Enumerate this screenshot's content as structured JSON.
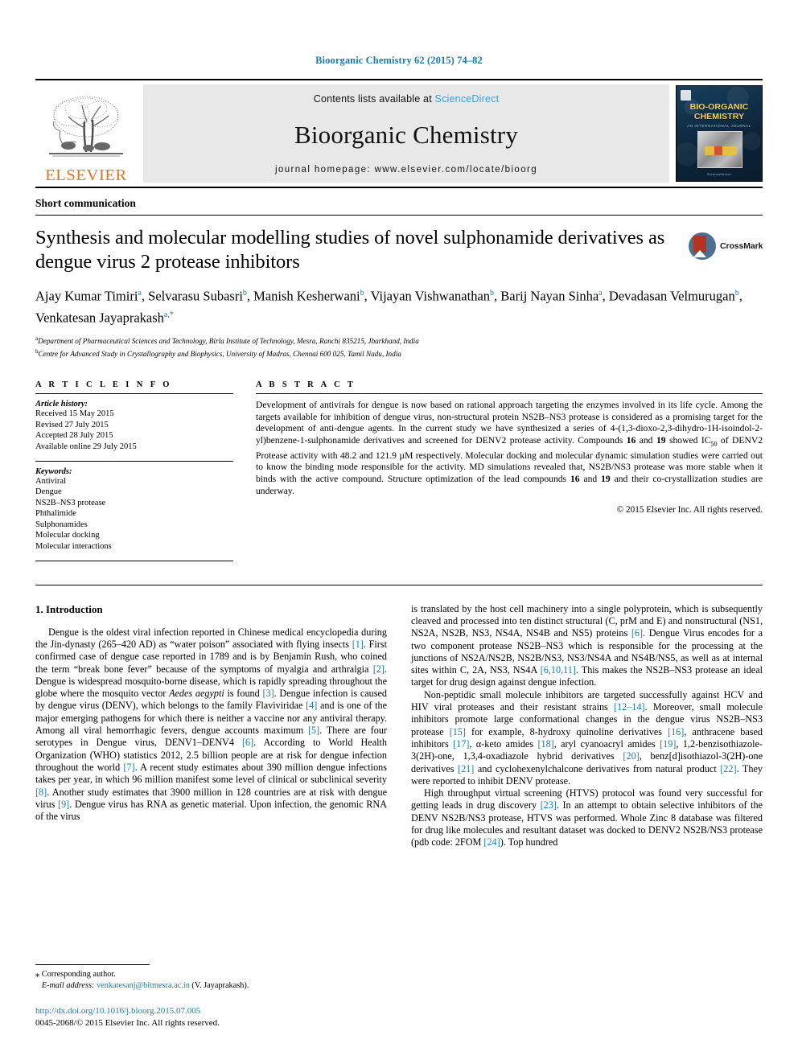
{
  "running_head": "Bioorganic Chemistry 62 (2015) 74–82",
  "masthead": {
    "publisher_name": "ELSEVIER",
    "contents_prefix": "Contents lists available at ",
    "sciencedirect": "ScienceDirect",
    "journal_name": "Bioorganic Chemistry",
    "homepage": "journal homepage: www.elsevier.com/locate/bioorg",
    "cover": {
      "title_line1": "BIO-ORGANIC",
      "title_line2": "CHEMISTRY",
      "subtitle": "AN INTERNATIONAL JOURNAL",
      "footer": "ScienceDirect"
    },
    "accent_blue": "#3b9fd8",
    "elsevier_orange": "#E9711C"
  },
  "article": {
    "type": "Short communication",
    "title": "Synthesis and molecular modelling studies of novel sulphonamide derivatives as dengue virus 2 protease inhibitors",
    "crossmark_label": "CrossMark",
    "authors": [
      {
        "name": "Ajay Kumar Timiri",
        "marks": "a",
        "sep": ", "
      },
      {
        "name": "Selvarasu Subasri",
        "marks": "b",
        "sep": ", "
      },
      {
        "name": "Manish Kesherwani",
        "marks": "b",
        "sep": ", "
      },
      {
        "name": "Vijayan Vishwanathan",
        "marks": "b",
        "sep": ", "
      },
      {
        "name": "Barij Nayan Sinha",
        "marks": "a",
        "sep": ", "
      },
      {
        "name": "Devadasan Velmurugan",
        "marks": "b",
        "sep": ", "
      },
      {
        "name": "Venkatesan Jayaprakash",
        "marks": "a,*",
        "sep": ""
      }
    ],
    "affiliations": [
      {
        "mark": "a",
        "text": "Department of Pharmaceutical Sciences and Technology, Birla Institute of Technology, Mesra, Ranchi 835215, Jharkhand, India"
      },
      {
        "mark": "b",
        "text": "Centre for Advanced Study in Crystallography and Biophysics, University of Madras, Chennai 600 025, Tamil Nadu, India"
      }
    ]
  },
  "info": {
    "heading": "A R T I C L E   I N F O",
    "history_label": "Article history:",
    "history": [
      "Received 15 May 2015",
      "Revised 27 July 2015",
      "Accepted 28 July 2015",
      "Available online 29 July 2015"
    ],
    "keywords_label": "Keywords:",
    "keywords": [
      "Antiviral",
      "Dengue",
      "NS2B–NS3 protease",
      "Phthalimide",
      "Sulphonamides",
      "Molecular docking",
      "Molecular interactions"
    ]
  },
  "abstract": {
    "heading": "A B S T R A C T",
    "part1": "Development of antivirals for dengue is now based on rational approach targeting the enzymes involved in its life cycle. Among the targets available for inhibition of dengue virus, non-structural protein NS2B–NS3 protease is considered as a promising target for the development of anti-dengue agents. In the current study we have synthesized a series of 4-(1,3-dioxo-2,3-dihydro-1H-isoindol-2-yl)benzene-1-sulphonamide derivatives and screened for DENV2 protease activity. Compounds ",
    "bold1": "16",
    "mid1": " and ",
    "bold2": "19",
    "part2": " showed IC",
    "sub": "50",
    "part3": " of DENV2 Protease activity with 48.2 and 121.9 µM respectively. Molecular docking and molecular dynamic simulation studies were carried out to know the binding mode responsible for the activity. MD simulations revealed that, NS2B/NS3 protease was more stable when it binds with the active compound. Structure optimization of the lead compounds ",
    "bold3": "16",
    "mid2": " and ",
    "bold4": "19",
    "part4": " and their co-crystallization studies are underway.",
    "copyright": "© 2015 Elsevier Inc. All rights reserved."
  },
  "body": {
    "section_title": "1. Introduction",
    "left_paragraphs": [
      {
        "segments": [
          {
            "t": "Dengue is the oldest viral infection reported in Chinese medical encyclopedia during the Jin-dynasty (265–420 AD) as “water poison” associated with flying insects "
          },
          {
            "t": "[1]",
            "k": "ref"
          },
          {
            "t": ". First confirmed case of dengue case reported in 1789 and is by Benjamin Rush, who coined the term “break bone fever” because of the symptoms of myalgia and arthralgia "
          },
          {
            "t": "[2]",
            "k": "ref"
          },
          {
            "t": ". Dengue is widespread mosquito-borne disease, which is rapidly spreading throughout the globe where the mosquito vector "
          },
          {
            "t": "Aedes aegypti",
            "k": "ital"
          },
          {
            "t": " is found "
          },
          {
            "t": "[3]",
            "k": "ref"
          },
          {
            "t": ". Dengue infection is caused by dengue virus (DENV), which belongs to the family Flaviviridae "
          },
          {
            "t": "[4]",
            "k": "ref"
          },
          {
            "t": " and is one of the major emerging pathogens for which there is neither a vaccine nor any antiviral therapy. Among all viral hemorrhagic fevers, dengue accounts maximum "
          },
          {
            "t": "[5]",
            "k": "ref"
          },
          {
            "t": ". There are four serotypes in Dengue virus, DENV1–DENV4 "
          },
          {
            "t": "[6]",
            "k": "ref"
          },
          {
            "t": ". According to World Health Organization (WHO) statistics 2012, 2.5 billion people are at risk for dengue infection throughout the world "
          },
          {
            "t": "[7]",
            "k": "ref"
          },
          {
            "t": ". A recent study estimates about 390 million dengue infections takes per year, in which 96 million manifest some level of clinical or subclinical severity "
          },
          {
            "t": "[8]",
            "k": "ref"
          },
          {
            "t": ". Another study estimates that 3900 million in 128 countries are at risk with dengue virus "
          },
          {
            "t": "[9]",
            "k": "ref"
          },
          {
            "t": ". Dengue virus has RNA as genetic material. Upon infection, the genomic RNA of the virus"
          }
        ]
      }
    ],
    "right_paragraphs": [
      {
        "no_indent": true,
        "segments": [
          {
            "t": "is translated by the host cell machinery into a single polyprotein, which is subsequently cleaved and processed into ten distinct structural (C, prM and E) and nonstructural (NS1, NS2A, NS2B, NS3, NS4A, NS4B and NS5) proteins "
          },
          {
            "t": "[6]",
            "k": "ref"
          },
          {
            "t": ". Dengue Virus encodes for a two component protease NS2B–NS3 which is responsible for the processing at the junctions of NS2A/NS2B, NS2B/NS3, NS3/NS4A and NS4B/NS5, as well as at internal sites within C, 2A, NS3, NS4A "
          },
          {
            "t": "[6,10,11]",
            "k": "ref"
          },
          {
            "t": ". This makes the NS2B–NS3 protease an ideal target for drug design against dengue infection."
          }
        ]
      },
      {
        "segments": [
          {
            "t": "Non-peptidic small molecule inhibitors are targeted successfully against HCV and HIV viral proteases and their resistant strains "
          },
          {
            "t": "[12–14]",
            "k": "ref"
          },
          {
            "t": ". Moreover, small molecule inhibitors promote large conformational changes in the dengue virus NS2B–NS3 protease "
          },
          {
            "t": "[15]",
            "k": "ref"
          },
          {
            "t": " for example, 8-hydroxy quinoline derivatives "
          },
          {
            "t": "[16]",
            "k": "ref"
          },
          {
            "t": ", anthracene based inhibitors "
          },
          {
            "t": "[17]",
            "k": "ref"
          },
          {
            "t": ", α-keto amides "
          },
          {
            "t": "[18]",
            "k": "ref"
          },
          {
            "t": ", aryl cyanoacryl amides "
          },
          {
            "t": "[19]",
            "k": "ref"
          },
          {
            "t": ", 1,2-benzisothiazole-3(2H)-one, 1,3,4-oxadiazole hybrid derivatives "
          },
          {
            "t": "[20]",
            "k": "ref"
          },
          {
            "t": ", benz[d]isothiazol-3(2H)-one derivatives "
          },
          {
            "t": "[21]",
            "k": "ref"
          },
          {
            "t": " and cyclohexenylchalcone derivatives from natural product "
          },
          {
            "t": "[22]",
            "k": "ref"
          },
          {
            "t": ". They were reported to inhibit DENV protease."
          }
        ]
      },
      {
        "segments": [
          {
            "t": "High throughput virtual screening (HTVS) protocol was found very successful for getting leads in drug discovery "
          },
          {
            "t": "[23]",
            "k": "ref"
          },
          {
            "t": ". In an attempt to obtain selective inhibitors of the DENV NS2B/NS3 protease, HTVS was performed. Whole Zinc 8 database was filtered for drug like molecules and resultant dataset was docked to DENV2 NS2B/NS3 protease (pdb code: 2FOM "
          },
          {
            "t": "[24]",
            "k": "ref"
          },
          {
            "t": "). Top hundred"
          }
        ]
      }
    ]
  },
  "footnote": {
    "corresponding": "⁎ Corresponding author.",
    "email_label": "E-mail address:",
    "email": "venkatesanj@bitmesra.ac.in",
    "email_suffix": " (V. Jayaprakash).",
    "doi": "http://dx.doi.org/10.1016/j.bioorg.2015.07.005",
    "issn": "0045-2068/© 2015 Elsevier Inc. All rights reserved."
  }
}
